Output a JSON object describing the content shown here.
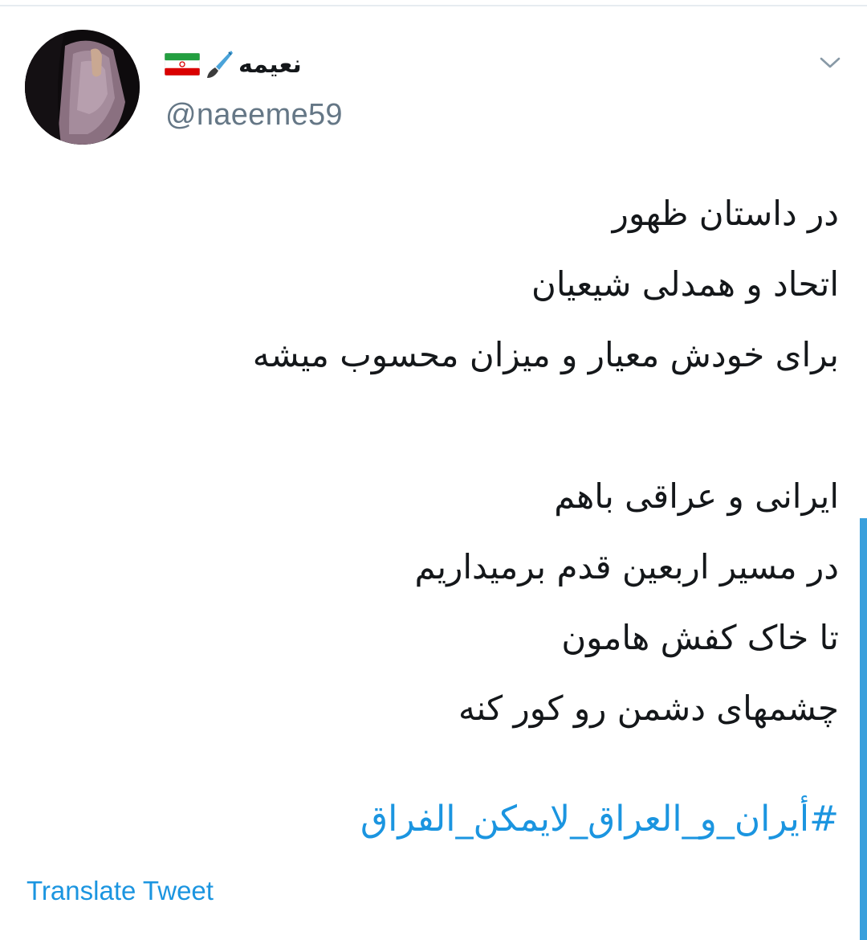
{
  "user": {
    "display_name": "نعیمه",
    "handle": "@naeeme59",
    "name_icons": [
      "paintbrush-icon",
      "iran-flag-icon"
    ]
  },
  "tweet": {
    "lines": [
      "در داستان ظهور",
      "اتحاد و همدلی شیعیان",
      "برای خودش معیار و میزان محسوب میشه",
      "",
      "ایرانی و عراقی باهم",
      "در مسیر اربعین قدم برمیداریم",
      "تا خاک کفش هامون",
      "چشمهای دشمن رو کور کنه"
    ],
    "hashtag": "#أيران_و_العراق_لايمكن_الفراق"
  },
  "actions": {
    "translate_label": "Translate Tweet",
    "menu_icon": "chevron-down-icon"
  },
  "colors": {
    "link": "#1b95e0",
    "text": "#14171a",
    "secondary": "#657786",
    "scrollbar": "#3aa0dc"
  }
}
